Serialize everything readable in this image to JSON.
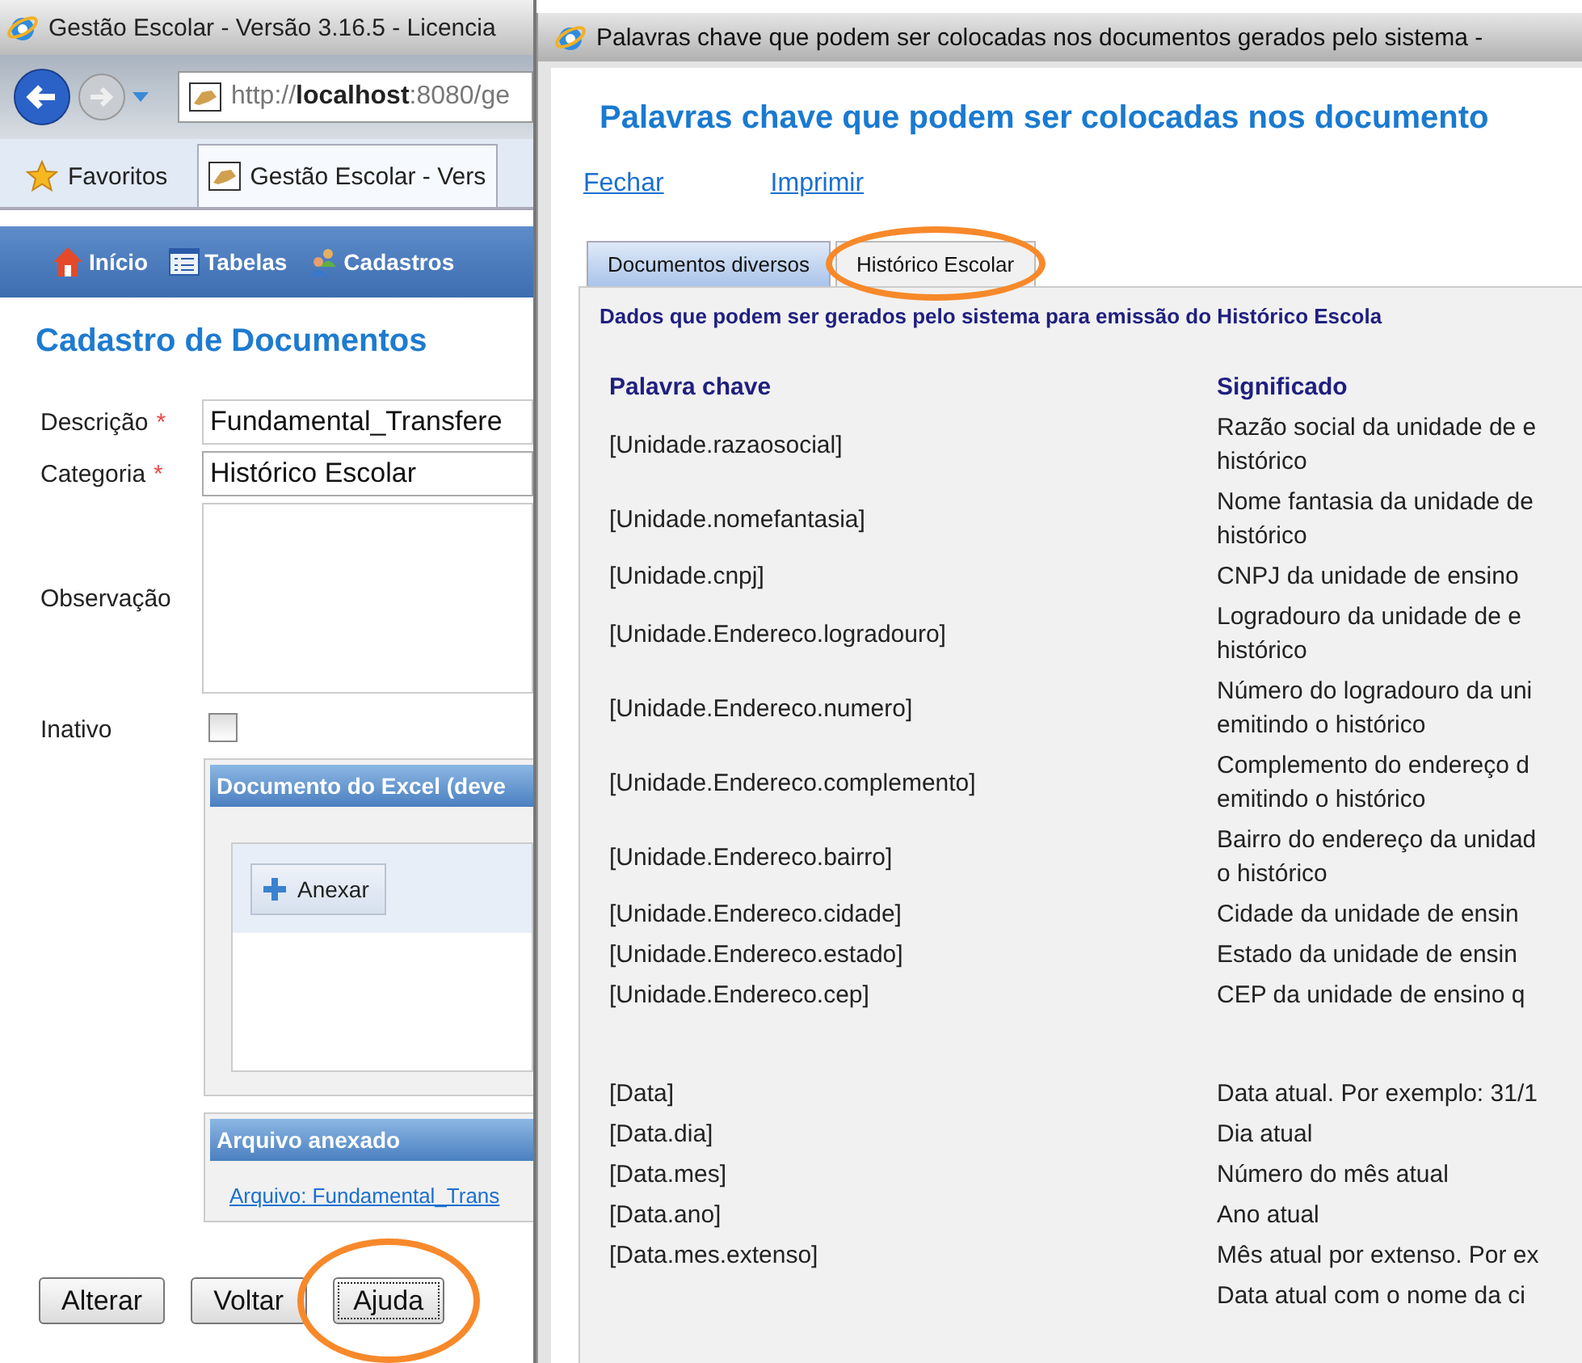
{
  "main_window": {
    "title": "Gestão Escolar - Versão 3.16.5 - Licencia",
    "address": "http://**localhost**:8080/ge",
    "favorites": "Favoritos",
    "browser_tab": "Gestão Escolar - Vers",
    "menu": [
      {
        "label": "Início",
        "kind": "home"
      },
      {
        "label": "Tabelas",
        "kind": "table"
      },
      {
        "label": "Cadastros",
        "kind": "people"
      }
    ],
    "heading": "Cadastro de Documentos",
    "fields": [
      {
        "kind": "text",
        "label": "Descrição",
        "marker": "*",
        "value": "Fundamental_Transfere"
      },
      {
        "kind": "select",
        "label": "Categoria",
        "marker": "*",
        "value": "Histórico Escolar"
      },
      {
        "kind": "textarea",
        "label": "Observação"
      },
      {
        "kind": "checkbox",
        "label": "Inativo",
        "checked": false
      }
    ],
    "upload_panel": {
      "title": "Documento do Excel (deve",
      "button": "Anexar"
    },
    "attached_panel": {
      "title": "Arquivo anexado",
      "link": "Arquivo: Fundamental_Trans"
    },
    "buttons": [
      {
        "label": "Alterar",
        "circled": false
      },
      {
        "label": "Voltar",
        "circled": false
      },
      {
        "label": "Ajuda",
        "circled": true
      }
    ]
  },
  "help_window": {
    "title": "Palavras chave que podem ser colocadas nos documentos gerados pelo sistema -",
    "heading": "Palavras chave que podem ser colocadas nos documento",
    "links": [
      "Fechar",
      "Imprimir"
    ],
    "tabs": [
      {
        "label": "Documentos diversos",
        "selected": false,
        "circled": false
      },
      {
        "label": "Histórico Escolar",
        "selected": true,
        "circled": true
      }
    ],
    "intro": "Dados que podem ser gerados pelo sistema para emissão do Histórico Escola",
    "table": {
      "columns": [
        "Palavra chave",
        "Significado"
      ],
      "groups": [
        [
          {
            "keyword": "[Unidade.razaosocial]",
            "meaning": [
              "Razão social da unidade de e",
              "histórico"
            ]
          },
          {
            "keyword": "[Unidade.nomefantasia]",
            "meaning": [
              "Nome fantasia da unidade de",
              "histórico"
            ]
          },
          {
            "keyword": "[Unidade.cnpj]",
            "meaning": [
              "CNPJ da unidade de ensino"
            ]
          },
          {
            "keyword": "[Unidade.Endereco.logradouro]",
            "meaning": [
              "Logradouro da unidade de e",
              "histórico"
            ]
          },
          {
            "keyword": "[Unidade.Endereco.numero]",
            "meaning": [
              "Número do logradouro da uni",
              "emitindo o histórico"
            ]
          },
          {
            "keyword": "[Unidade.Endereco.complemento]",
            "meaning": [
              "Complemento do endereço d",
              "emitindo o histórico"
            ]
          },
          {
            "keyword": "[Unidade.Endereco.bairro]",
            "meaning": [
              "Bairro do endereço da unidad",
              "o histórico"
            ]
          },
          {
            "keyword": "[Unidade.Endereco.cidade]",
            "meaning": [
              "Cidade da unidade de ensin"
            ]
          },
          {
            "keyword": "[Unidade.Endereco.estado]",
            "meaning": [
              "Estado da unidade de ensin"
            ]
          },
          {
            "keyword": "[Unidade.Endereco.cep]",
            "meaning": [
              "CEP da unidade de ensino q"
            ]
          }
        ],
        [
          {
            "keyword": "[Data]",
            "meaning": [
              "Data atual. Por exemplo: 31/1"
            ]
          },
          {
            "keyword": "[Data.dia]",
            "meaning": [
              "Dia atual"
            ]
          },
          {
            "keyword": "[Data.mes]",
            "meaning": [
              "Número do mês atual"
            ]
          },
          {
            "keyword": "[Data.ano]",
            "meaning": [
              "Ano atual"
            ]
          },
          {
            "keyword": "[Data.mes.extenso]",
            "meaning": [
              "Mês atual por extenso. Por ex"
            ]
          },
          {
            "meaning": [
              "Data atual com o nome da ci"
            ]
          }
        ]
      ]
    }
  }
}
